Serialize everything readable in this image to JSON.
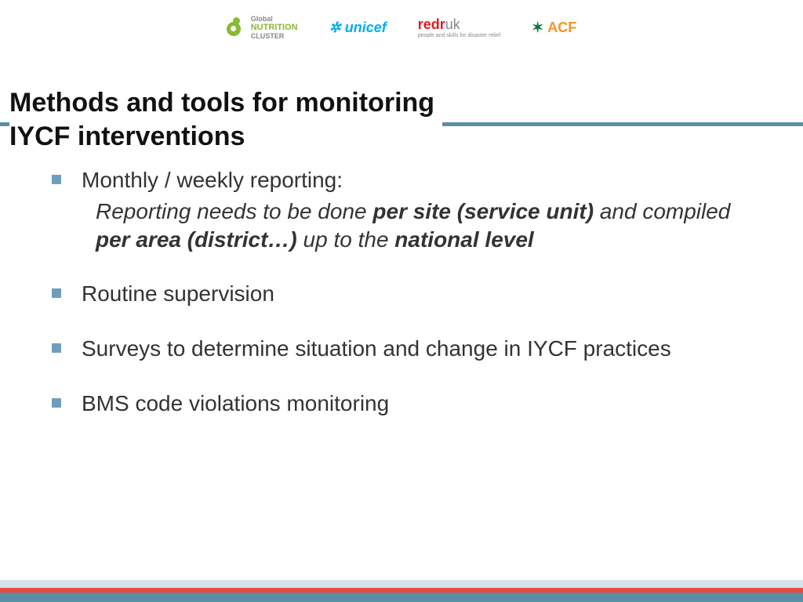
{
  "logos": {
    "gnc_top": "Global",
    "gnc_mid": "NUTRITION",
    "gnc_bot": "CLUSTER",
    "unicef": "unicef",
    "redr_a": "redr",
    "redr_b": "uk",
    "redr_sub": "people and skills for disaster relief",
    "acf": "ACF"
  },
  "title": {
    "line1": "Methods and tools for monitoring",
    "line2": "IYCF interventions"
  },
  "bullets": {
    "b1": "Monthly / weekly reporting:",
    "b1_sub_a": "Reporting needs to be done ",
    "b1_sub_b": "per site (service unit) ",
    "b1_sub_c": "and compiled ",
    "b1_sub_d": "per area (district…) ",
    "b1_sub_e": "up to the ",
    "b1_sub_f": "national level",
    "b2": "Routine supervision",
    "b3": "Surveys to determine situation and change in IYCF practices",
    "b4": "BMS code violations monitoring"
  }
}
